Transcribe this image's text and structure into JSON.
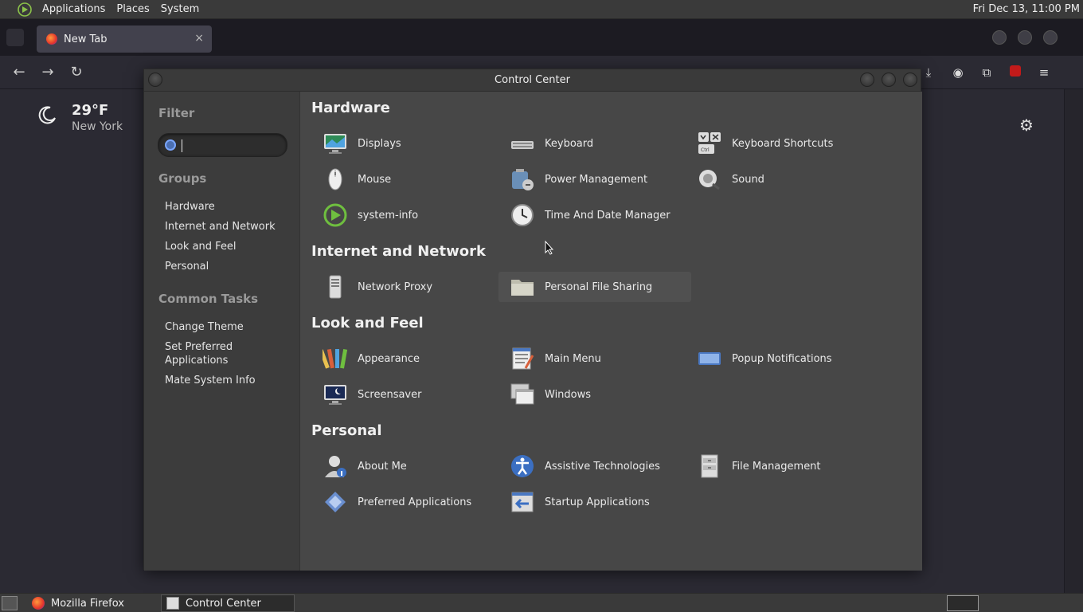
{
  "top_panel": {
    "menus": [
      "Applications",
      "Places",
      "System"
    ],
    "clock": "Fri Dec 13, 11:00 PM"
  },
  "firefox": {
    "tab_title": "New Tab",
    "tab_close": "×",
    "weather": {
      "temp": "29°F",
      "city": "New York"
    }
  },
  "control_center": {
    "title": "Control Center",
    "sidebar": {
      "filter_label": "Filter",
      "groups_label": "Groups",
      "groups": [
        "Hardware",
        "Internet and Network",
        "Look and Feel",
        "Personal"
      ],
      "common_tasks_label": "Common Tasks",
      "tasks": [
        "Change Theme",
        "Set Preferred Applications",
        "Mate System Info"
      ]
    },
    "sections": [
      {
        "title": "Hardware",
        "items": [
          {
            "label": "Displays",
            "icon": "display-icon"
          },
          {
            "label": "Keyboard",
            "icon": "keyboard-icon"
          },
          {
            "label": "Keyboard Shortcuts",
            "icon": "keyboard-shortcuts-icon"
          },
          {
            "label": "Mouse",
            "icon": "mouse-icon"
          },
          {
            "label": "Power Management",
            "icon": "power-management-icon"
          },
          {
            "label": "Sound",
            "icon": "sound-icon"
          },
          {
            "label": "system-info",
            "icon": "system-info-icon"
          },
          {
            "label": "Time And Date Manager",
            "icon": "clock-icon"
          }
        ]
      },
      {
        "title": "Internet and Network",
        "items": [
          {
            "label": "Network Proxy",
            "icon": "network-proxy-icon"
          },
          {
            "label": "Personal File Sharing",
            "icon": "folder-share-icon"
          }
        ]
      },
      {
        "title": "Look and Feel",
        "items": [
          {
            "label": "Appearance",
            "icon": "appearance-icon"
          },
          {
            "label": "Main Menu",
            "icon": "main-menu-icon"
          },
          {
            "label": "Popup Notifications",
            "icon": "popup-notifications-icon"
          },
          {
            "label": "Screensaver",
            "icon": "screensaver-icon"
          },
          {
            "label": "Windows",
            "icon": "windows-icon"
          }
        ]
      },
      {
        "title": "Personal",
        "items": [
          {
            "label": "About Me",
            "icon": "about-me-icon"
          },
          {
            "label": "Assistive Technologies",
            "icon": "accessibility-icon"
          },
          {
            "label": "File Management",
            "icon": "file-management-icon"
          },
          {
            "label": "Preferred Applications",
            "icon": "preferred-apps-icon"
          },
          {
            "label": "Startup Applications",
            "icon": "startup-apps-icon"
          }
        ]
      }
    ]
  },
  "taskbar": {
    "tasks": [
      "Mozilla Firefox",
      "Control Center"
    ]
  },
  "colors": {
    "accent": "#7aa6ff",
    "panel": "#3a3a3a",
    "dialog_main": "#474747"
  }
}
